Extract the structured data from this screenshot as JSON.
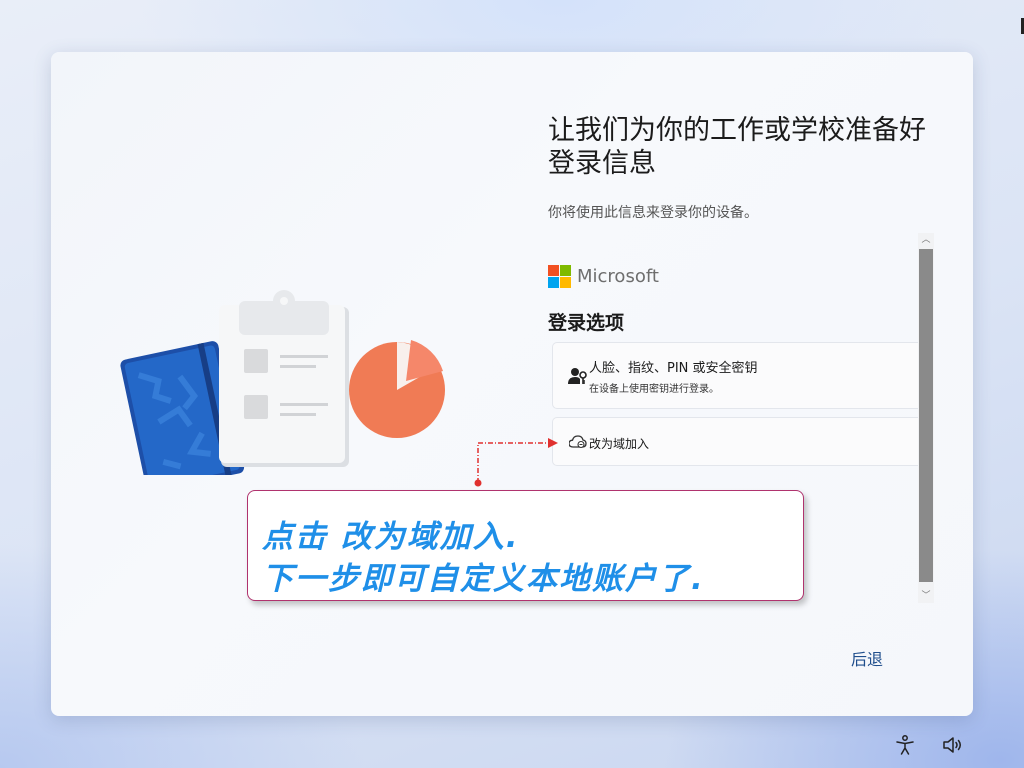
{
  "window": {
    "heading": "让我们为你的工作或学校准备好登录信息",
    "subtitle": "你将使用此信息来登录你的设备。"
  },
  "brand": {
    "name": "Microsoft",
    "logo_colors": [
      "#f25022",
      "#7fba00",
      "#00a4ef",
      "#ffb900"
    ]
  },
  "sign_in": {
    "section_title": "登录选项",
    "options": [
      {
        "icon": "person-key-icon",
        "title": "人脸、指纹、PIN 或安全密钥",
        "description": "在设备上使用密钥进行登录。"
      },
      {
        "icon": "cloud-domain-icon",
        "title": "改为域加入"
      }
    ]
  },
  "footer": {
    "back_label": "后退"
  },
  "annotation": {
    "line1": "点击 改为域加入.",
    "line2": "下一步即可自定义本地账户了.",
    "text_color": "#1f8fe8",
    "border_color": "#b0336e",
    "arrow_color": "#e0312f"
  },
  "taskbar": {
    "icons": [
      "accessibility-icon",
      "volume-icon"
    ]
  },
  "colors": {
    "accent": "#1f4e8c"
  }
}
